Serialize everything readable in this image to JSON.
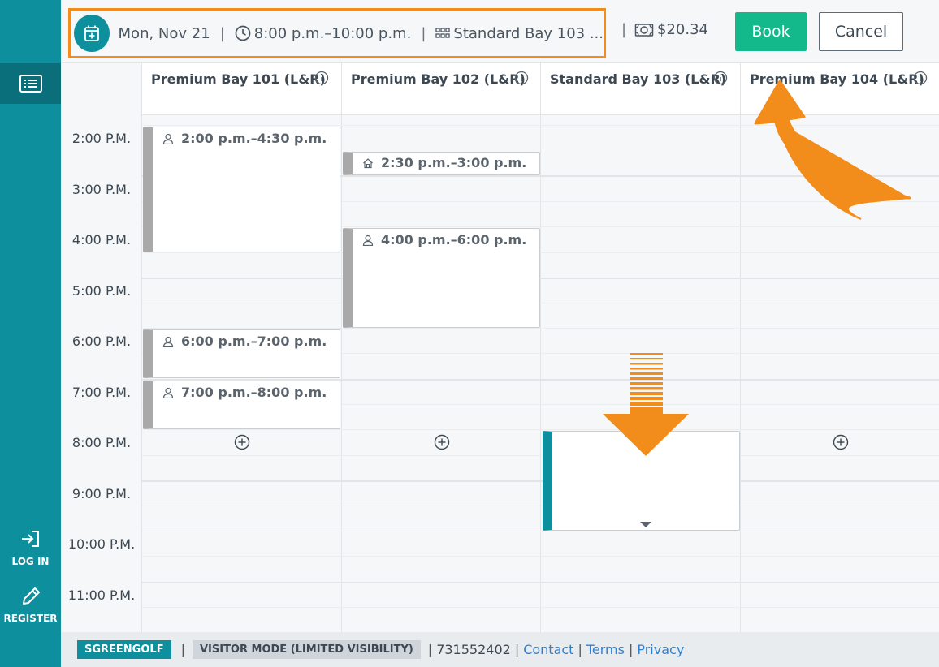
{
  "booking": {
    "date": "Mon, Nov 21",
    "time": "8:00 p.m.–10:00 p.m.",
    "bay": "Standard Bay 103 ...",
    "price": "$20.34",
    "separator": "|"
  },
  "actions": {
    "book_label": "Book",
    "cancel_label": "Cancel"
  },
  "sidebar": {
    "menu_icon": "list-icon",
    "login_label": "LOG IN",
    "register_label": "REGISTER"
  },
  "columns": [
    {
      "name": "Premium Bay 101 (L&R)"
    },
    {
      "name": "Premium Bay 102 (L&R)"
    },
    {
      "name": "Standard Bay 103 (L&R)"
    },
    {
      "name": "Premium Bay 104 (L&R)"
    }
  ],
  "times": [
    "2:00 P.M.",
    "3:00 P.M.",
    "4:00 P.M.",
    "5:00 P.M.",
    "6:00 P.M.",
    "7:00 P.M.",
    "8:00 P.M.",
    "9:00 P.M.",
    "10:00 P.M.",
    "11:00 P.M."
  ],
  "events": [
    {
      "bay": "Premium Bay 101 (L&R)",
      "label": "2:00 p.m.–4:30 p.m.",
      "icon": "person-icon"
    },
    {
      "bay": "Premium Bay 102 (L&R)",
      "label": "2:30 p.m.–3:00 p.m.",
      "icon": "home-icon"
    },
    {
      "bay": "Premium Bay 102 (L&R)",
      "label": "4:00 p.m.–6:00 p.m.",
      "icon": "person-icon"
    },
    {
      "bay": "Premium Bay 101 (L&R)",
      "label": "6:00 p.m.–7:00 p.m.",
      "icon": "person-icon"
    },
    {
      "bay": "Premium Bay 101 (L&R)",
      "label": "7:00 p.m.–8:00 p.m.",
      "icon": "person-icon"
    }
  ],
  "footer": {
    "brand": "SGREENGOLF",
    "mode": "VISITOR MODE (LIMITED VISIBILITY)",
    "phone": "731552402",
    "separator": "|",
    "links": [
      "Contact",
      "Terms",
      "Privacy"
    ]
  },
  "colors": {
    "accent": "#0e8f9e",
    "book": "#13b98a",
    "annotation": "#f28c1b",
    "booked_bar": "#a9a9a9"
  }
}
